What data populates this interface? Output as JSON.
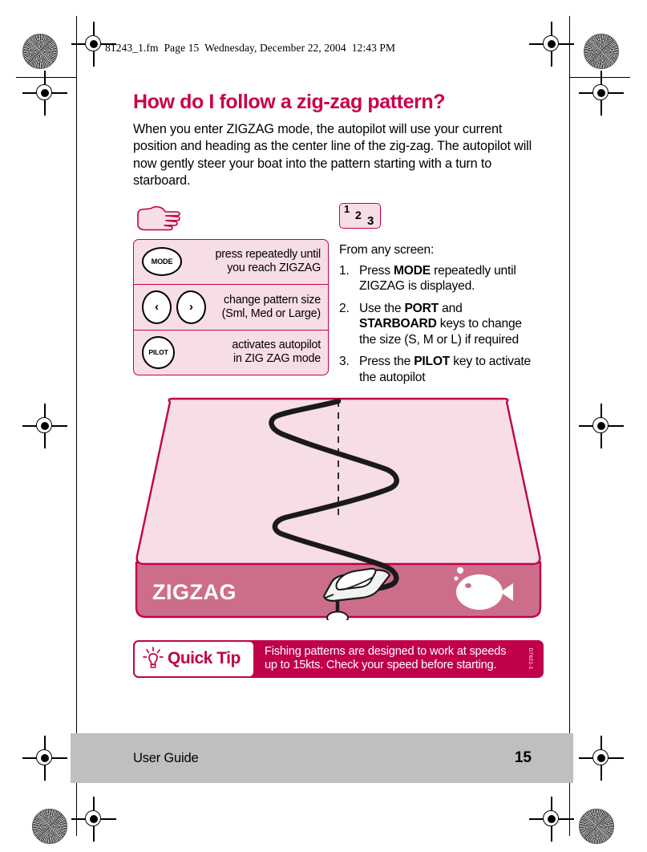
{
  "film_header": "81243_1.fm  Page 15  Wednesday, December 22, 2004  12:43 PM",
  "page": {
    "title": "How do I follow a zig-zag pattern?",
    "intro": "When you enter ZIGZAG mode, the autopilot will use your current position and heading as the center line of the zig-zag. The autopilot will now gently steer your boat into the pattern starting with a turn to starboard."
  },
  "hand_icon": "pointing-hand-icon",
  "steps_badge": {
    "n1": "1",
    "n2": "2",
    "n3": "3"
  },
  "keys_panel": {
    "rows": [
      {
        "glyphs": [
          "MODE"
        ],
        "glyph_type": "oval",
        "text_line1": "press repeatedly until",
        "text_line2": "you reach ZIGZAG"
      },
      {
        "glyphs": [
          "‹",
          "›"
        ],
        "glyph_type": "arrows",
        "text_line1": "change pattern size",
        "text_line2": "(Sml, Med or Large)"
      },
      {
        "glyphs": [
          "PILOT"
        ],
        "glyph_type": "round",
        "text_line1": "activates autopilot",
        "text_line2": "in ZIG ZAG mode"
      }
    ]
  },
  "instructions": {
    "intro": "From any screen:",
    "steps": [
      {
        "num": "1.",
        "parts": [
          {
            "t": "Press ",
            "b": false
          },
          {
            "t": "MODE",
            "b": true
          },
          {
            "t": " repeatedly until ZIGZAG is displayed.",
            "b": false
          }
        ]
      },
      {
        "num": "2.",
        "parts": [
          {
            "t": "Use the ",
            "b": false
          },
          {
            "t": "PORT",
            "b": true
          },
          {
            "t": " and ",
            "b": false
          },
          {
            "t": "STARBOARD",
            "b": true
          },
          {
            "t": " keys to change the size (S, M or L) if required",
            "b": false
          }
        ]
      },
      {
        "num": "3.",
        "parts": [
          {
            "t": "Press the ",
            "b": false
          },
          {
            "t": "PILOT",
            "b": true
          },
          {
            "t": " key to activate the autopilot",
            "b": false
          }
        ]
      }
    ]
  },
  "illustration": {
    "mode_label": "ZIGZAG",
    "fish_icon": "fish-icon",
    "boat_icon": "boat-icon",
    "center_line": "dashed-center-line",
    "track": "zigzag-track-path",
    "colors": {
      "slab_top": "#F7DDE5",
      "slab_front": "#CC6E8A",
      "outline": "#C0004B",
      "track": "#1A1A1A"
    }
  },
  "quick_tip": {
    "icon": "lightbulb-icon",
    "label": "Quick Tip",
    "text_line1": "Fishing patterns are designed to work at speeds",
    "text_line2": "up to 15kts. Check your speed before starting.",
    "code": "D7621-1"
  },
  "footer": {
    "title": "User Guide",
    "page_number": "15"
  },
  "colors": {
    "brand_crimson": "#C8004B",
    "tip_crimson": "#C0004B",
    "pale_pink": "#F7DDE5",
    "footer_grey": "#BFBFBF"
  }
}
